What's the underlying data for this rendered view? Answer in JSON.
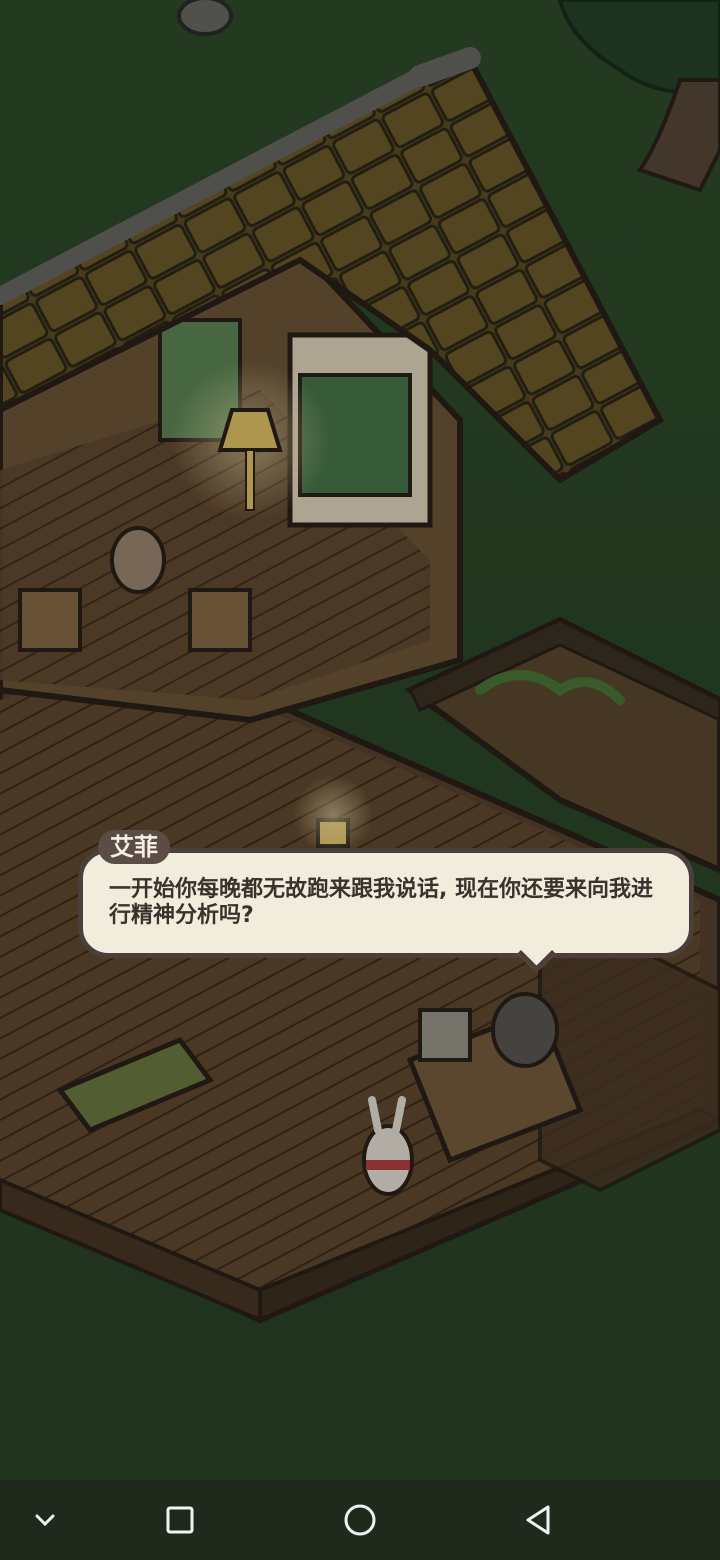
{
  "dialogue": {
    "speaker": "艾菲",
    "text": "一开始你每晚都无故跑来跟我说话, 现在你还要来向我进行精神分析吗?"
  },
  "navbar": {
    "buttons": [
      {
        "name": "nav-collapse-button",
        "icon": "chevron-down-icon"
      },
      {
        "name": "nav-recents-button",
        "icon": "square-icon"
      },
      {
        "name": "nav-home-button",
        "icon": "circle-icon"
      },
      {
        "name": "nav-back-button",
        "icon": "triangle-back-icon"
      }
    ]
  },
  "colors": {
    "grass": "#2f4a2a",
    "roof": "#6b5a2a",
    "wood": "#6a5034",
    "bubble": "#f1ecdc",
    "speaker_tag": "#5b4d46",
    "navbar": "#1f2a1d"
  }
}
